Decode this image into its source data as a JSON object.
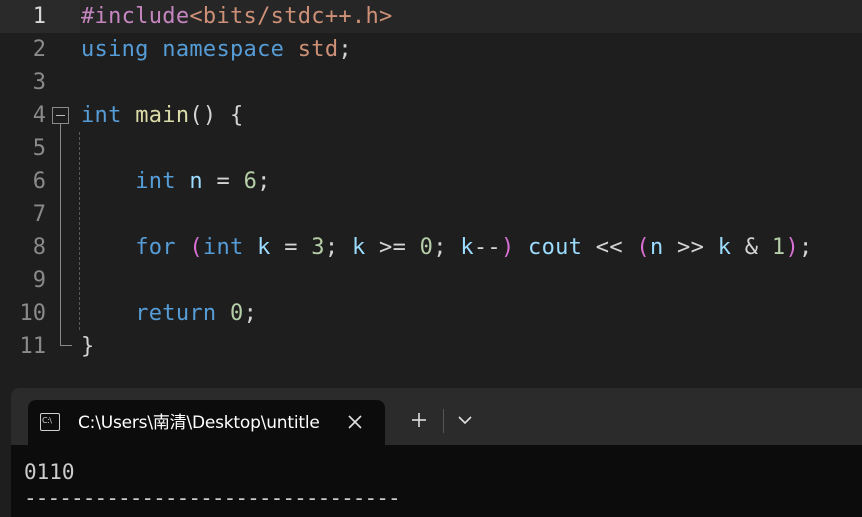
{
  "editor": {
    "line_numbers": [
      "1",
      "2",
      "3",
      "4",
      "5",
      "6",
      "7",
      "8",
      "9",
      "10",
      "11"
    ],
    "current_line": 1,
    "lines": [
      [
        {
          "t": "#include",
          "c": "pre"
        },
        {
          "t": "<bits/stdc++.h>",
          "c": "inc"
        }
      ],
      [
        {
          "t": "using",
          "c": "kw"
        },
        {
          "t": " ",
          "c": "plain"
        },
        {
          "t": "namespace",
          "c": "kw"
        },
        {
          "t": " ",
          "c": "plain"
        },
        {
          "t": "std",
          "c": "std"
        },
        {
          "t": ";",
          "c": "punc"
        }
      ],
      [],
      [
        {
          "t": "int",
          "c": "kw"
        },
        {
          "t": " ",
          "c": "plain"
        },
        {
          "t": "main",
          "c": "fn"
        },
        {
          "t": "() {",
          "c": "punc"
        }
      ],
      [],
      [
        {
          "t": "    ",
          "c": "plain"
        },
        {
          "t": "int",
          "c": "kw"
        },
        {
          "t": " ",
          "c": "plain"
        },
        {
          "t": "n",
          "c": "var"
        },
        {
          "t": " = ",
          "c": "punc"
        },
        {
          "t": "6",
          "c": "num"
        },
        {
          "t": ";",
          "c": "punc"
        }
      ],
      [],
      [
        {
          "t": "    ",
          "c": "plain"
        },
        {
          "t": "for",
          "c": "kw"
        },
        {
          "t": " ",
          "c": "plain"
        },
        {
          "t": "(",
          "c": "paren2"
        },
        {
          "t": "int",
          "c": "kw"
        },
        {
          "t": " ",
          "c": "plain"
        },
        {
          "t": "k",
          "c": "var"
        },
        {
          "t": " = ",
          "c": "punc"
        },
        {
          "t": "3",
          "c": "num"
        },
        {
          "t": "; ",
          "c": "punc"
        },
        {
          "t": "k",
          "c": "var"
        },
        {
          "t": " >= ",
          "c": "punc"
        },
        {
          "t": "0",
          "c": "num"
        },
        {
          "t": "; ",
          "c": "punc"
        },
        {
          "t": "k",
          "c": "var"
        },
        {
          "t": "--",
          "c": "punc"
        },
        {
          "t": ")",
          "c": "paren2"
        },
        {
          "t": " ",
          "c": "plain"
        },
        {
          "t": "cout",
          "c": "cout"
        },
        {
          "t": " << ",
          "c": "punc"
        },
        {
          "t": "(",
          "c": "paren2"
        },
        {
          "t": "n",
          "c": "var"
        },
        {
          "t": " >> ",
          "c": "punc"
        },
        {
          "t": "k",
          "c": "var"
        },
        {
          "t": " & ",
          "c": "punc"
        },
        {
          "t": "1",
          "c": "num"
        },
        {
          "t": ")",
          "c": "paren2"
        },
        {
          "t": ";",
          "c": "punc"
        }
      ],
      [],
      [
        {
          "t": "    ",
          "c": "plain"
        },
        {
          "t": "return",
          "c": "kw"
        },
        {
          "t": " ",
          "c": "plain"
        },
        {
          "t": "0",
          "c": "num"
        },
        {
          "t": ";",
          "c": "punc"
        }
      ],
      [
        {
          "t": "}",
          "c": "punc"
        }
      ]
    ]
  },
  "terminal": {
    "tab_title": "C:\\Users\\南清\\Desktop\\untitle",
    "tab_icon_text": "C:\\",
    "tab_icon": "terminal-icon",
    "close_icon": "close-icon",
    "new_tab_icon": "plus-icon",
    "dropdown_icon": "chevron-down-icon",
    "output": "0110",
    "rule": "--------------------------------"
  },
  "colors": {
    "editor_bg": "#1e1e1e",
    "keyword": "#569cd6",
    "preprocessor": "#c586c0",
    "include": "#ce9178",
    "function": "#dcdcaa",
    "variable": "#9cdcfe",
    "number": "#b5cea8",
    "terminal_bg": "#0c0c0c",
    "tabbar_bg": "#2b2b2b"
  }
}
